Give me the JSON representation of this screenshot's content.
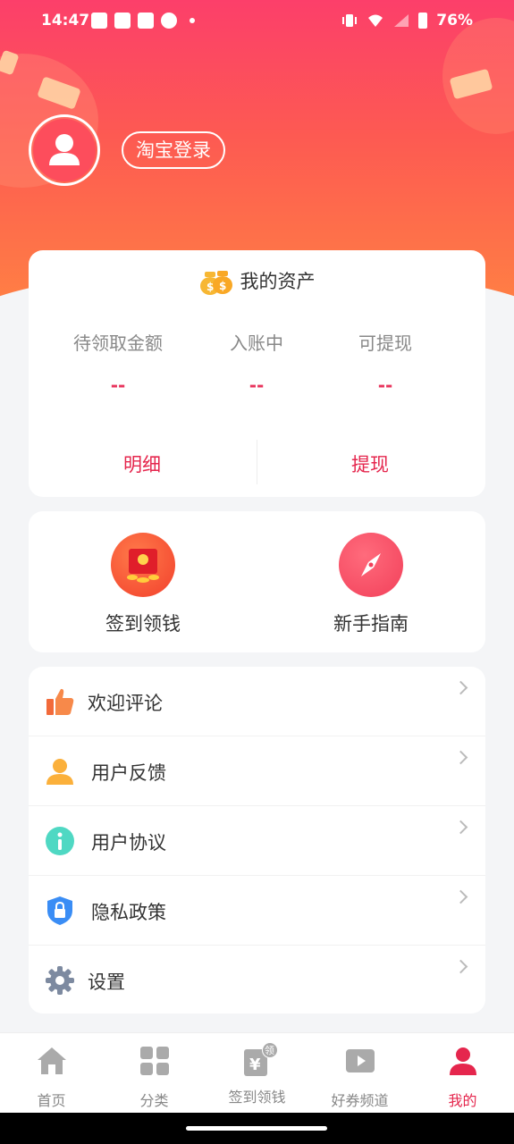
{
  "status": {
    "time": "14:47",
    "battery": "76%"
  },
  "header": {
    "login_label": "淘宝登录"
  },
  "assets": {
    "title": "我的资产",
    "cols": [
      {
        "label": "待领取金额",
        "value": "--"
      },
      {
        "label": "入账中",
        "value": "--"
      },
      {
        "label": "可提现",
        "value": "--"
      }
    ],
    "detail_label": "明细",
    "withdraw_label": "提现"
  },
  "quick": [
    {
      "label": "签到领钱",
      "icon": "red-envelope-icon"
    },
    {
      "label": "新手指南",
      "icon": "compass-icon"
    }
  ],
  "menu": [
    {
      "label": "欢迎评论",
      "icon": "thumbs-up-icon"
    },
    {
      "label": "用户反馈",
      "icon": "user-icon"
    },
    {
      "label": "用户协议",
      "icon": "info-icon"
    },
    {
      "label": "隐私政策",
      "icon": "shield-lock-icon"
    },
    {
      "label": "设置",
      "icon": "gear-icon"
    }
  ],
  "tabs": [
    {
      "label": "首页",
      "icon": "home-icon"
    },
    {
      "label": "分类",
      "icon": "grid-icon"
    },
    {
      "label": "签到领钱",
      "icon": "coupon-yen-icon",
      "badge": "领"
    },
    {
      "label": "好券频道",
      "icon": "video-ticket-icon"
    },
    {
      "label": "我的",
      "icon": "profile-icon",
      "active": true
    }
  ],
  "colors": {
    "accent": "#e5264d",
    "gradient_top": "#fc3f6a",
    "gradient_bottom": "#ff7f44"
  }
}
